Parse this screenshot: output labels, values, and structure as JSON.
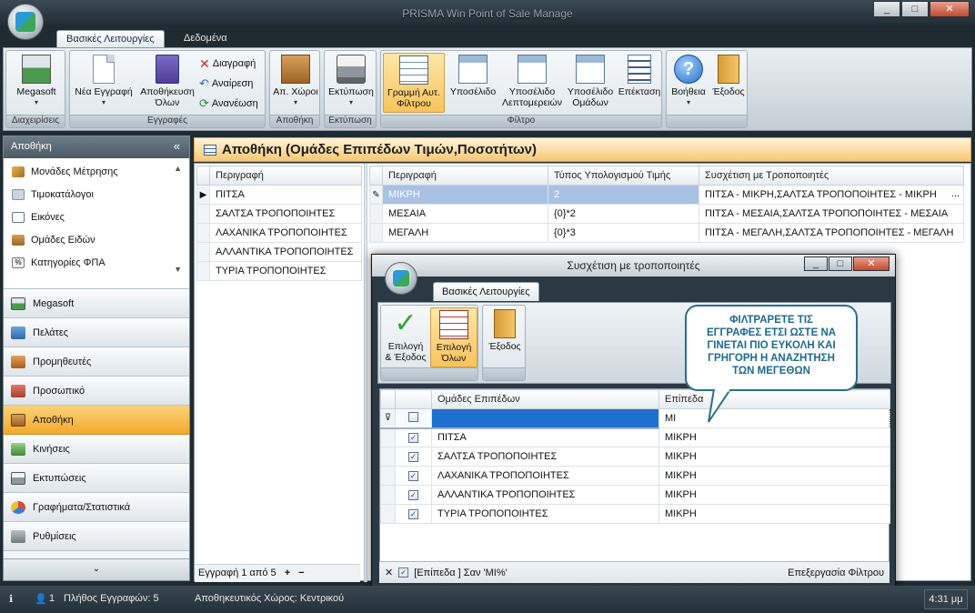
{
  "window": {
    "title": "PRISMA Win Point of Sale Manage",
    "min": "_",
    "max": "□",
    "close": "✕"
  },
  "ribbon": {
    "tabs": [
      "Βασικές Λειτουργίες",
      "Δεδομένα"
    ],
    "groups": {
      "management": {
        "label": "Διαχειρίσεις",
        "megasoft": "Megasoft"
      },
      "records": {
        "label": "Εγγραφές",
        "new": "Νέα Εγγραφή",
        "save_all_1": "Αποθήκευση",
        "save_all_2": "Όλων",
        "delete": "Διαγραφή",
        "undo": "Αναίρεση",
        "refresh": "Ανανέωση"
      },
      "warehouse": {
        "label": "Αποθήκη",
        "spaces": "Απ. Χώροι"
      },
      "printing": {
        "label": "Εκτύπωση",
        "print": "Εκτύπωση"
      },
      "filter": {
        "label": "Φίλτρο",
        "auto_row_1": "Γραμμή Αυτ.",
        "auto_row_2": "Φίλτρου",
        "subpanel": "Υποσέλιδο",
        "subpanel_details_1": "Υποσέλιδο",
        "subpanel_details_2": "Λεπτομερειών",
        "subpanel_groups_1": "Υποσέλιδο",
        "subpanel_groups_2": "Ομάδων",
        "expand": "Επέκταση"
      },
      "other": {
        "help": "Βοήθεια",
        "exit": "Έξοδος"
      }
    }
  },
  "nav": {
    "header": "Αποθήκη",
    "collapse": "«",
    "sub_items": [
      "Μονάδες Μέτρησης",
      "Τιμοκατάλογοι",
      "Εικόνες",
      "Ομάδες Ειδών",
      "Κατηγορίες ΦΠΑ"
    ],
    "buttons": [
      "Megasoft",
      "Πελάτες",
      "Προμηθευτές",
      "Προσωπικό",
      "Αποθήκη",
      "Κινήσεις",
      "Εκτυπώσεις",
      "Γραφήματα/Στατιστικά",
      "Ρυθμίσεις"
    ],
    "footer": "⌄"
  },
  "main": {
    "title": "Αποθήκη (Ομάδες Επιπέδων Τιμών,Ποσοτήτων)",
    "left_grid": {
      "header": "Περιγραφή",
      "rows": [
        "ΠΙΤΣΑ",
        "ΣΑΛΤΣΑ ΤΡΟΠΟΠΟΙΗΤΕΣ",
        "ΛΑΧΑΝΙΚΑ ΤΡΟΠΟΠΟΙΗΤΕΣ",
        "ΑΛΛΑΝΤΙΚΑ ΤΡΟΠΟΠΟΙΗΤΕΣ",
        "ΤΥΡΙΑ ΤΡΟΠΟΠΟΙΗΤΕΣ"
      ],
      "footer": "Εγγραφή 1 από 5"
    },
    "right_grid": {
      "headers": [
        "Περιγραφή",
        "Τύπος Υπολογισμού Τιμής",
        "Συσχέτιση με Τροποποιητές"
      ],
      "rows": [
        [
          "ΜΙΚΡΗ",
          "2",
          "ΠΙΤΣΑ - ΜΙΚΡΗ,ΣΑΛΤΣΑ ΤΡΟΠΟΠΟΙΗΤΕΣ - ΜΙΚΡΗ"
        ],
        [
          "ΜΕΣΑΙΑ",
          "{0}*2",
          "ΠΙΤΣΑ - ΜΕΣΑΙΑ,ΣΑΛΤΣΑ ΤΡΟΠΟΠΟΙΗΤΕΣ - ΜΕΣΑΙΑ"
        ],
        [
          "ΜΕΓΑΛΗ",
          "{0}*3",
          "ΠΙΤΣΑ - ΜΕΓΑΛΗ,ΣΑΛΤΣΑ ΤΡΟΠΟΠΟΙΗΤΕΣ - ΜΕΓΑΛΗ"
        ]
      ],
      "ellipsis": "..."
    }
  },
  "dialog": {
    "title": "Συσχέτιση με τροποποιητές",
    "tab": "Βασικές Λειτουργίες",
    "buttons": {
      "select_exit_1": "Επιλογή",
      "select_exit_2": "& Έξοδος",
      "select_all_1": "Επιλογή",
      "select_all_2": "Όλων",
      "exit": "Έξοδος"
    },
    "grid": {
      "headers": [
        "Ομάδες Επιπέδων",
        "Επίπεδα"
      ],
      "filter_value": "ΜΙ",
      "rows": [
        [
          "ΠΙΤΣΑ",
          "ΜΙΚΡΗ"
        ],
        [
          "ΣΑΛΤΣΑ ΤΡΟΠΟΠΟΙΗΤΕΣ",
          "ΜΙΚΡΗ"
        ],
        [
          "ΛΑΧΑΝΙΚΑ ΤΡΟΠΟΠΟΙΗΤΕΣ",
          "ΜΙΚΡΗ"
        ],
        [
          "ΑΛΛΑΝΤΙΚΑ ΤΡΟΠΟΠΟΙΗΤΕΣ",
          "ΜΙΚΡΗ"
        ],
        [
          "ΤΥΡΙΑ ΤΡΟΠΟΠΟΙΗΤΕΣ",
          "ΜΙΚΡΗ"
        ]
      ]
    },
    "filter_text": "[Επίπεδα ] Σαν 'ΜΙ%'",
    "filter_edit": "Επεξεργασία Φίλτρου",
    "filter_close": "✕"
  },
  "callout": {
    "lines": [
      "ΦΙΛΤΡΑΡΕΤΕ ΤΙΣ",
      "ΕΓΓΡΑΦΕΣ ΕΤΣΙ ΩΣΤΕ ΝΑ",
      "ΓΙΝΕΤΑΙ ΠΙΟ ΕΥΚΟΛΗ ΚΑΙ",
      "ΓΡΗΓΟΡΗ Η ΑΝΑΖΗΤΗΣΗ",
      "ΤΩΝ ΜΕΓΕΘΩΝ"
    ]
  },
  "status": {
    "users": "1",
    "records": "Πλήθος Εγγραφών: 5",
    "warehouse": "Αποθηκευτικός Χώρος: Κεντρικού",
    "time": "4:31 μμ"
  }
}
